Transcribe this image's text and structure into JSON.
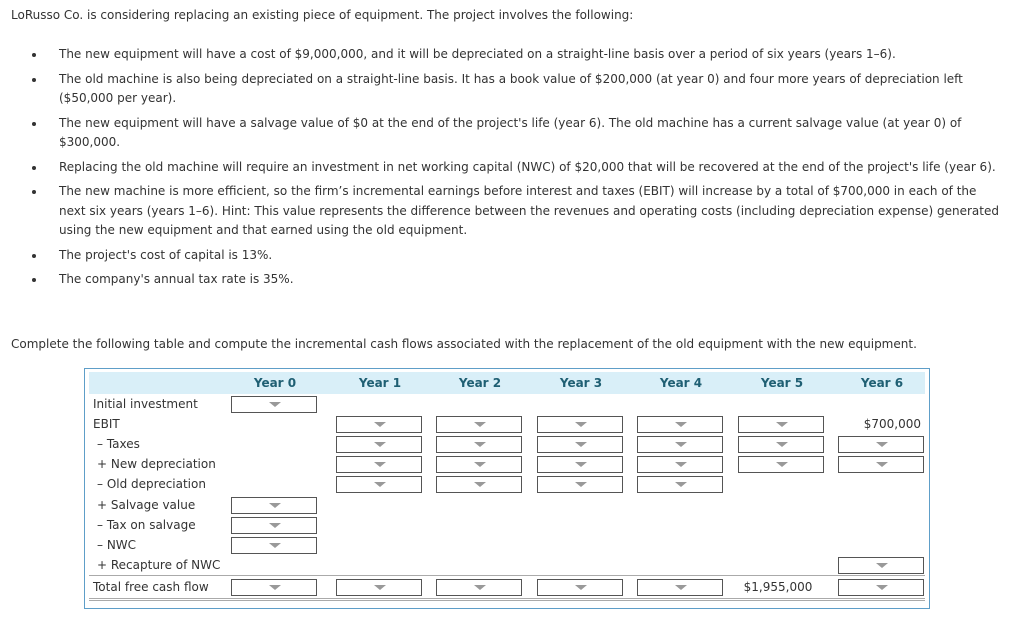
{
  "intro": "LoRusso Co. is considering replacing an existing piece of equipment. The project involves the following:",
  "bullets": [
    "The new equipment will have a cost of $9,000,000, and it will be depreciated on a straight-line basis over a period of six years (years 1–6).",
    "The old machine is also being depreciated on a straight-line basis. It has a book value of $200,000 (at year 0) and four more years of depreciation left ($50,000 per year).",
    "The new equipment will have a salvage value of $0 at the end of the project's life (year 6). The old machine has a current salvage value (at year 0) of $300,000.",
    "Replacing the old machine will require an investment in net working capital (NWC) of $20,000 that will be recovered at the end of the project's life (year 6).",
    "The new machine is more efficient, so the firm’s incremental earnings before interest and taxes (EBIT) will increase by a total of $700,000 in each of the next six years (years 1–6). Hint: This value represents the difference between the revenues and operating costs (including depreciation expense) generated using the new equipment and that earned using the old equipment.",
    "The project's cost of capital is 13%.",
    "The company's annual tax rate is 35%."
  ],
  "instruction": "Complete the following table and compute the incremental cash flows associated with the replacement of the old equipment with the new equipment.",
  "table": {
    "years": [
      "Year 0",
      "Year 1",
      "Year 2",
      "Year 3",
      "Year 4",
      "Year 5",
      "Year 6"
    ],
    "rows": [
      "Initial investment",
      "EBIT",
      "– Taxes",
      "+ New depreciation",
      "– Old depreciation",
      "+ Salvage value",
      "– Tax on salvage",
      "– NWC",
      "+ Recapture of NWC",
      "Total free cash flow"
    ],
    "given_values": {
      "ebit_year6": "$700,000",
      "total_fcf_year5": "$1,955,000"
    }
  }
}
